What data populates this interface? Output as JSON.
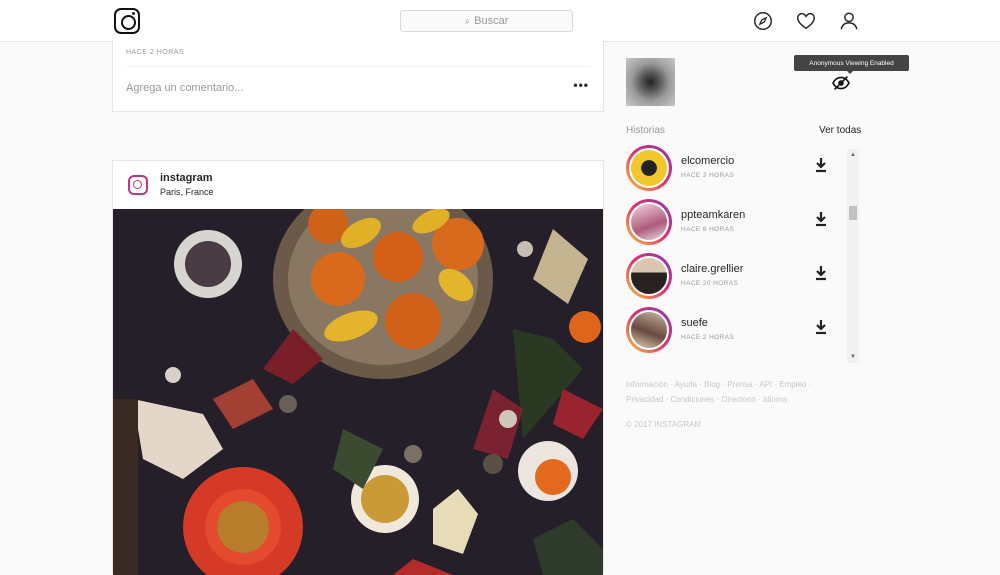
{
  "header": {
    "search_placeholder": "Buscar",
    "icons": [
      "instagram-logo-icon",
      "search-icon",
      "compass-icon",
      "heart-icon",
      "user-icon"
    ]
  },
  "previous_post": {
    "time": "HACE 2 HORAS",
    "comment_placeholder": "Agrega un comentario...",
    "more": "•••"
  },
  "post": {
    "username": "instagram",
    "location": "Paris, France"
  },
  "sidebar": {
    "tooltip": "Anonymous Viewing Enabled",
    "stories_title": "Historias",
    "see_all": "Ver todas",
    "stories": [
      {
        "username": "elcomercio",
        "time": "HACE 3 HORAS"
      },
      {
        "username": "ppteamkaren",
        "time": "HACE 8 HORAS"
      },
      {
        "username": "claire.grellier",
        "time": "HACE 20 HORAS"
      },
      {
        "username": "suefe",
        "time": "HACE 2 HORAS"
      }
    ],
    "footer_links": "Información · Ayuda · Blog · Prensa · API · Empleo · Privacidad · Condiciones · Directorio · Idioma",
    "copyright": "© 2017 INSTAGRAM"
  },
  "colors": {
    "background": "#fafafa",
    "border": "#e6e6e6",
    "muted_text": "#999999",
    "story_ring_start": "#f9c63c",
    "story_ring_end": "#833ab4"
  }
}
